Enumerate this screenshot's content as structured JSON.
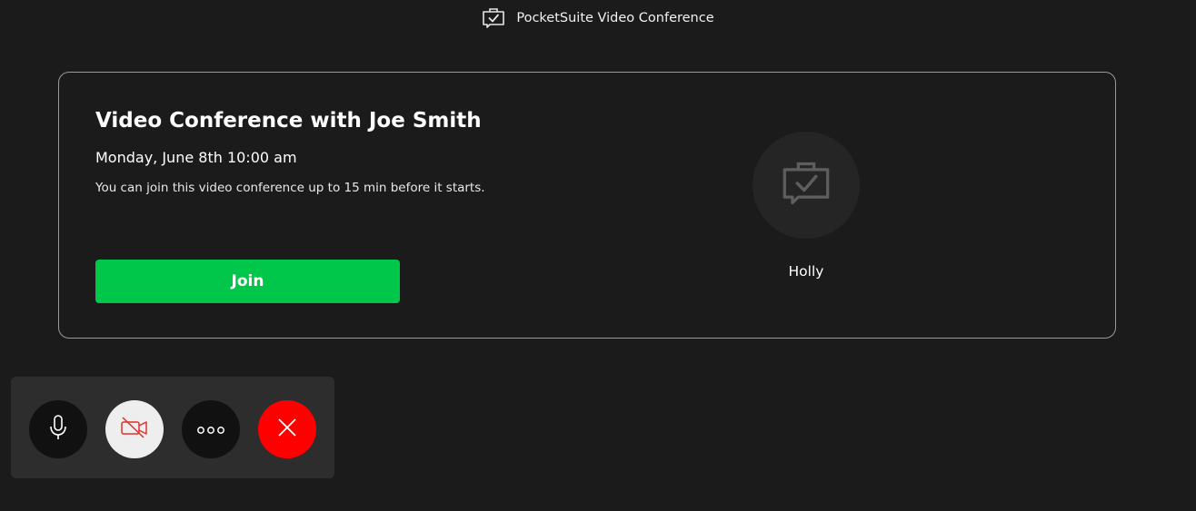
{
  "header": {
    "logo_icon": "briefcase-check-icon",
    "title": "PocketSuite Video Conference"
  },
  "card": {
    "title": "Video Conference with Joe Smith",
    "datetime": "Monday, June 8th 10:00 am",
    "note": "You can join this video conference up to 15 min before it starts.",
    "join_label": "Join",
    "host_avatar_icon": "briefcase-check-icon",
    "host_name": "Holly"
  },
  "controls": {
    "mic_icon": "microphone-icon",
    "camera_icon": "camera-off-icon",
    "more_icon": "more-options-icon",
    "end_call_icon": "close-icon"
  },
  "colors": {
    "background": "#1b1b1b",
    "join_green": "#00c74a",
    "end_call_red": "#ff0000",
    "camera_off_red": "#e0302c"
  }
}
